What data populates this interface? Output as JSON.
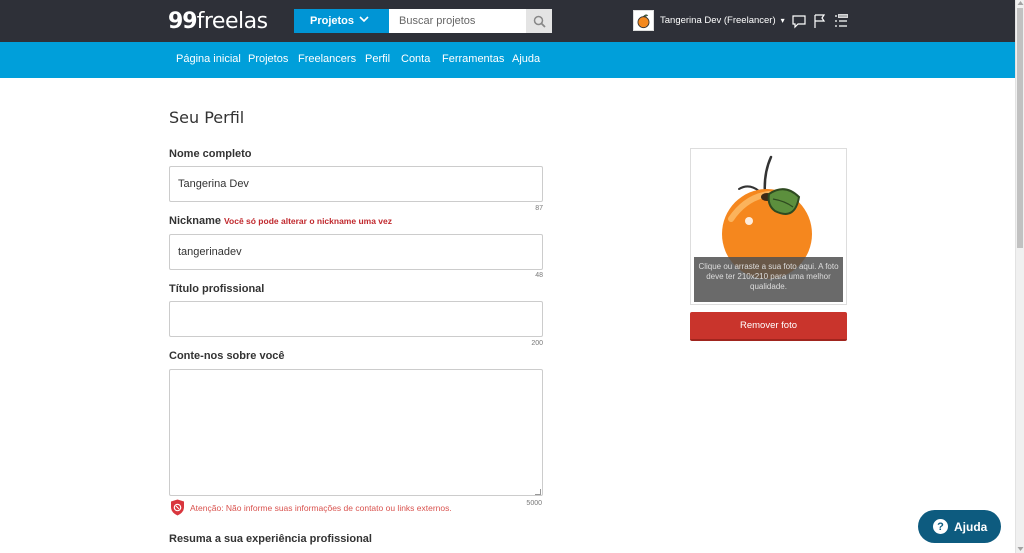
{
  "header": {
    "logo_number": "99",
    "logo_word": "freelas",
    "search_category": "Projetos",
    "search_placeholder": "Buscar projetos",
    "user_label": "Tangerina Dev  (Freelancer)",
    "user_caret": "▾"
  },
  "nav": {
    "items": [
      "Página inicial",
      "Projetos",
      "Freelancers",
      "Perfil",
      "Conta",
      "Ferramentas",
      "Ajuda"
    ]
  },
  "profile": {
    "page_title": "Seu Perfil",
    "full_name_label": "Nome completo",
    "full_name_value": "Tangerina Dev",
    "full_name_counter": "87",
    "nickname_label": "Nickname",
    "nickname_warning": "Você só pode alterar o nickname uma vez",
    "nickname_value": "tangerinadev",
    "nickname_counter": "48",
    "title_label": "Título profissional",
    "title_value": "",
    "title_counter": "200",
    "about_label": "Conte-nos sobre você",
    "about_counter": "5000",
    "contact_warning": "Atenção: Não informe suas informações de contato ou links externos.",
    "experience_label": "Resuma a sua experiência profissional"
  },
  "photo": {
    "hint": "Clique ou arraste a sua foto aqui. A foto deve ter 210x210 para uma melhor qualidade.",
    "remove_label": "Remover foto"
  },
  "help": {
    "label": "Ajuda",
    "icon_char": "?"
  },
  "colors": {
    "topbar": "#2e3038",
    "navbar": "#009fda",
    "accent_blue": "#0095d5",
    "danger": "#c9342c",
    "help": "#0d5b7f"
  }
}
